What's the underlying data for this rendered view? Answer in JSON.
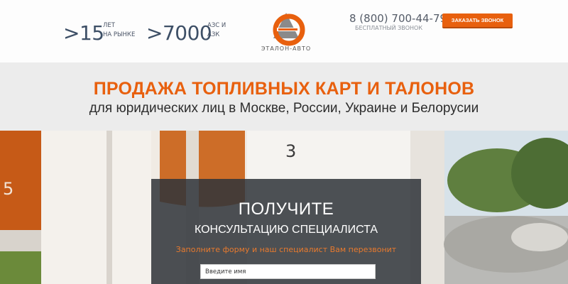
{
  "header": {
    "stats": [
      {
        "value": ">15",
        "label_line1": "ЛЕТ",
        "label_line2": "НА РЫНКЕ"
      },
      {
        "value": ">7000",
        "label_line1": "АЗС И",
        "label_line2": "АЗК"
      }
    ],
    "logo": {
      "icon": "logo-icon",
      "text": "ЭТАЛОН-АВТО"
    },
    "phone": "8 (800) 700-44-79",
    "phone_note": "БЕСПЛАТНЫЙ ЗВОНОК",
    "callback_button": "ЗАКАЗАТЬ ЗВОНОК"
  },
  "hero": {
    "title": "ПРОДАЖА ТОПЛИВНЫХ КАРТ И ТАЛОНОВ",
    "subtitle": "для юридических лиц в Москве, России, Украине и Белорусии",
    "pump_numbers": [
      "5",
      "3"
    ]
  },
  "form": {
    "title": "ПОЛУЧИТЕ",
    "subtitle": "КОНСУЛЬТАЦИЮ СПЕЦИАЛИСТА",
    "hint": "Заполните форму и наш специалист Вам перезвонит",
    "name_placeholder": "Введите имя"
  },
  "colors": {
    "accent": "#e8600e",
    "stat_text": "#3d4f66",
    "form_overlay": "#30343a"
  }
}
